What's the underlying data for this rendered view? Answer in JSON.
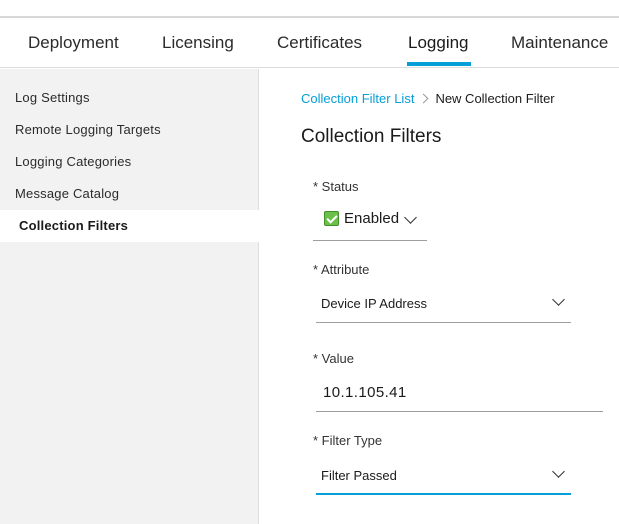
{
  "tabs": [
    {
      "label": "Deployment"
    },
    {
      "label": "Licensing"
    },
    {
      "label": "Certificates"
    },
    {
      "label": "Logging"
    },
    {
      "label": "Maintenance"
    }
  ],
  "active_tab": "Logging",
  "sidebar": {
    "items": [
      {
        "label": "Log Settings"
      },
      {
        "label": "Remote Logging Targets"
      },
      {
        "label": "Logging Categories"
      },
      {
        "label": "Message Catalog"
      },
      {
        "label": "Collection Filters"
      }
    ],
    "active_item": "Collection Filters"
  },
  "breadcrumb": {
    "parent": "Collection Filter List",
    "current": "New Collection Filter"
  },
  "page_title": "Collection Filters",
  "form": {
    "status": {
      "label": "* Status",
      "value": "Enabled",
      "checked": true
    },
    "attribute": {
      "label": "* Attribute",
      "value": "Device IP Address"
    },
    "value": {
      "label": "* Value",
      "value": "10.1.105.41"
    },
    "filter_type": {
      "label": "* Filter Type",
      "value": "Filter Passed"
    }
  },
  "colors": {
    "accent": "#049fd9",
    "check_green": "#6cc04a",
    "sidebar_bg": "#f2f2f2"
  }
}
